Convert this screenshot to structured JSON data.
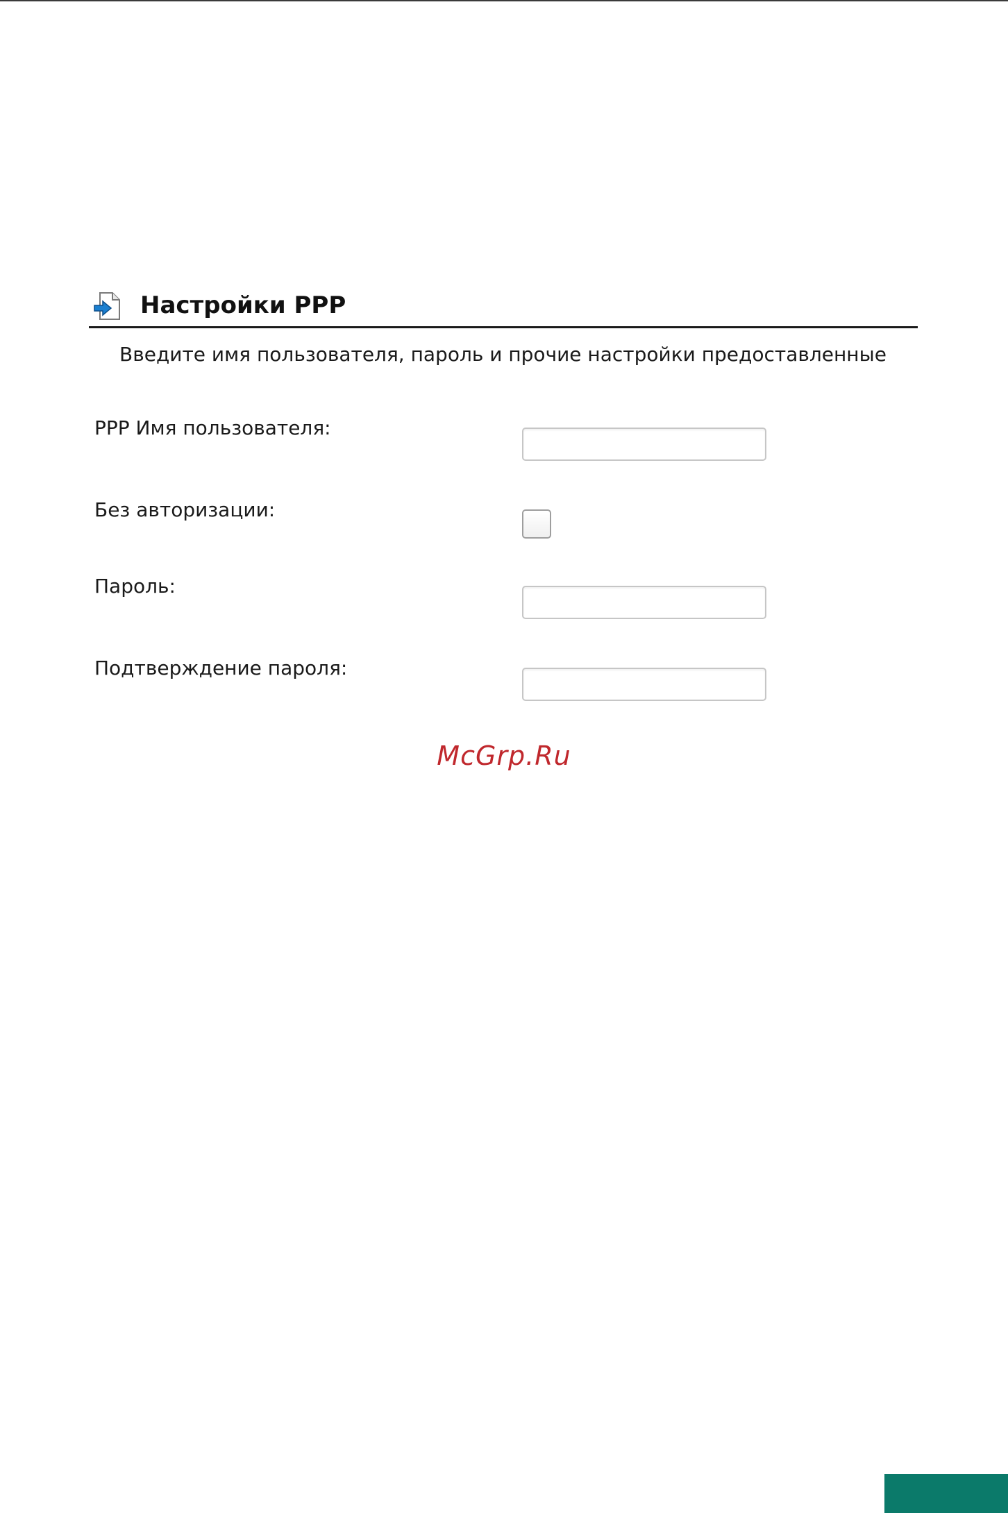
{
  "section": {
    "title": "Настройки PPP",
    "icon": "document-arrow-icon",
    "intro": "Введите имя пользователя, пароль и прочие настройки предоставленные"
  },
  "fields": {
    "username": {
      "label": "PPP Имя пользователя:",
      "value": ""
    },
    "no_auth": {
      "label": "Без авторизации:",
      "checked": false
    },
    "password": {
      "label": "Пароль:",
      "value": ""
    },
    "password_confirm": {
      "label": "Подтверждение пароля:",
      "value": ""
    }
  },
  "watermark": "McGrp.Ru",
  "colors": {
    "watermark": "#c0282d",
    "corner_tab": "#0b7a6a",
    "icon_arrow": "#1a7fd0"
  }
}
